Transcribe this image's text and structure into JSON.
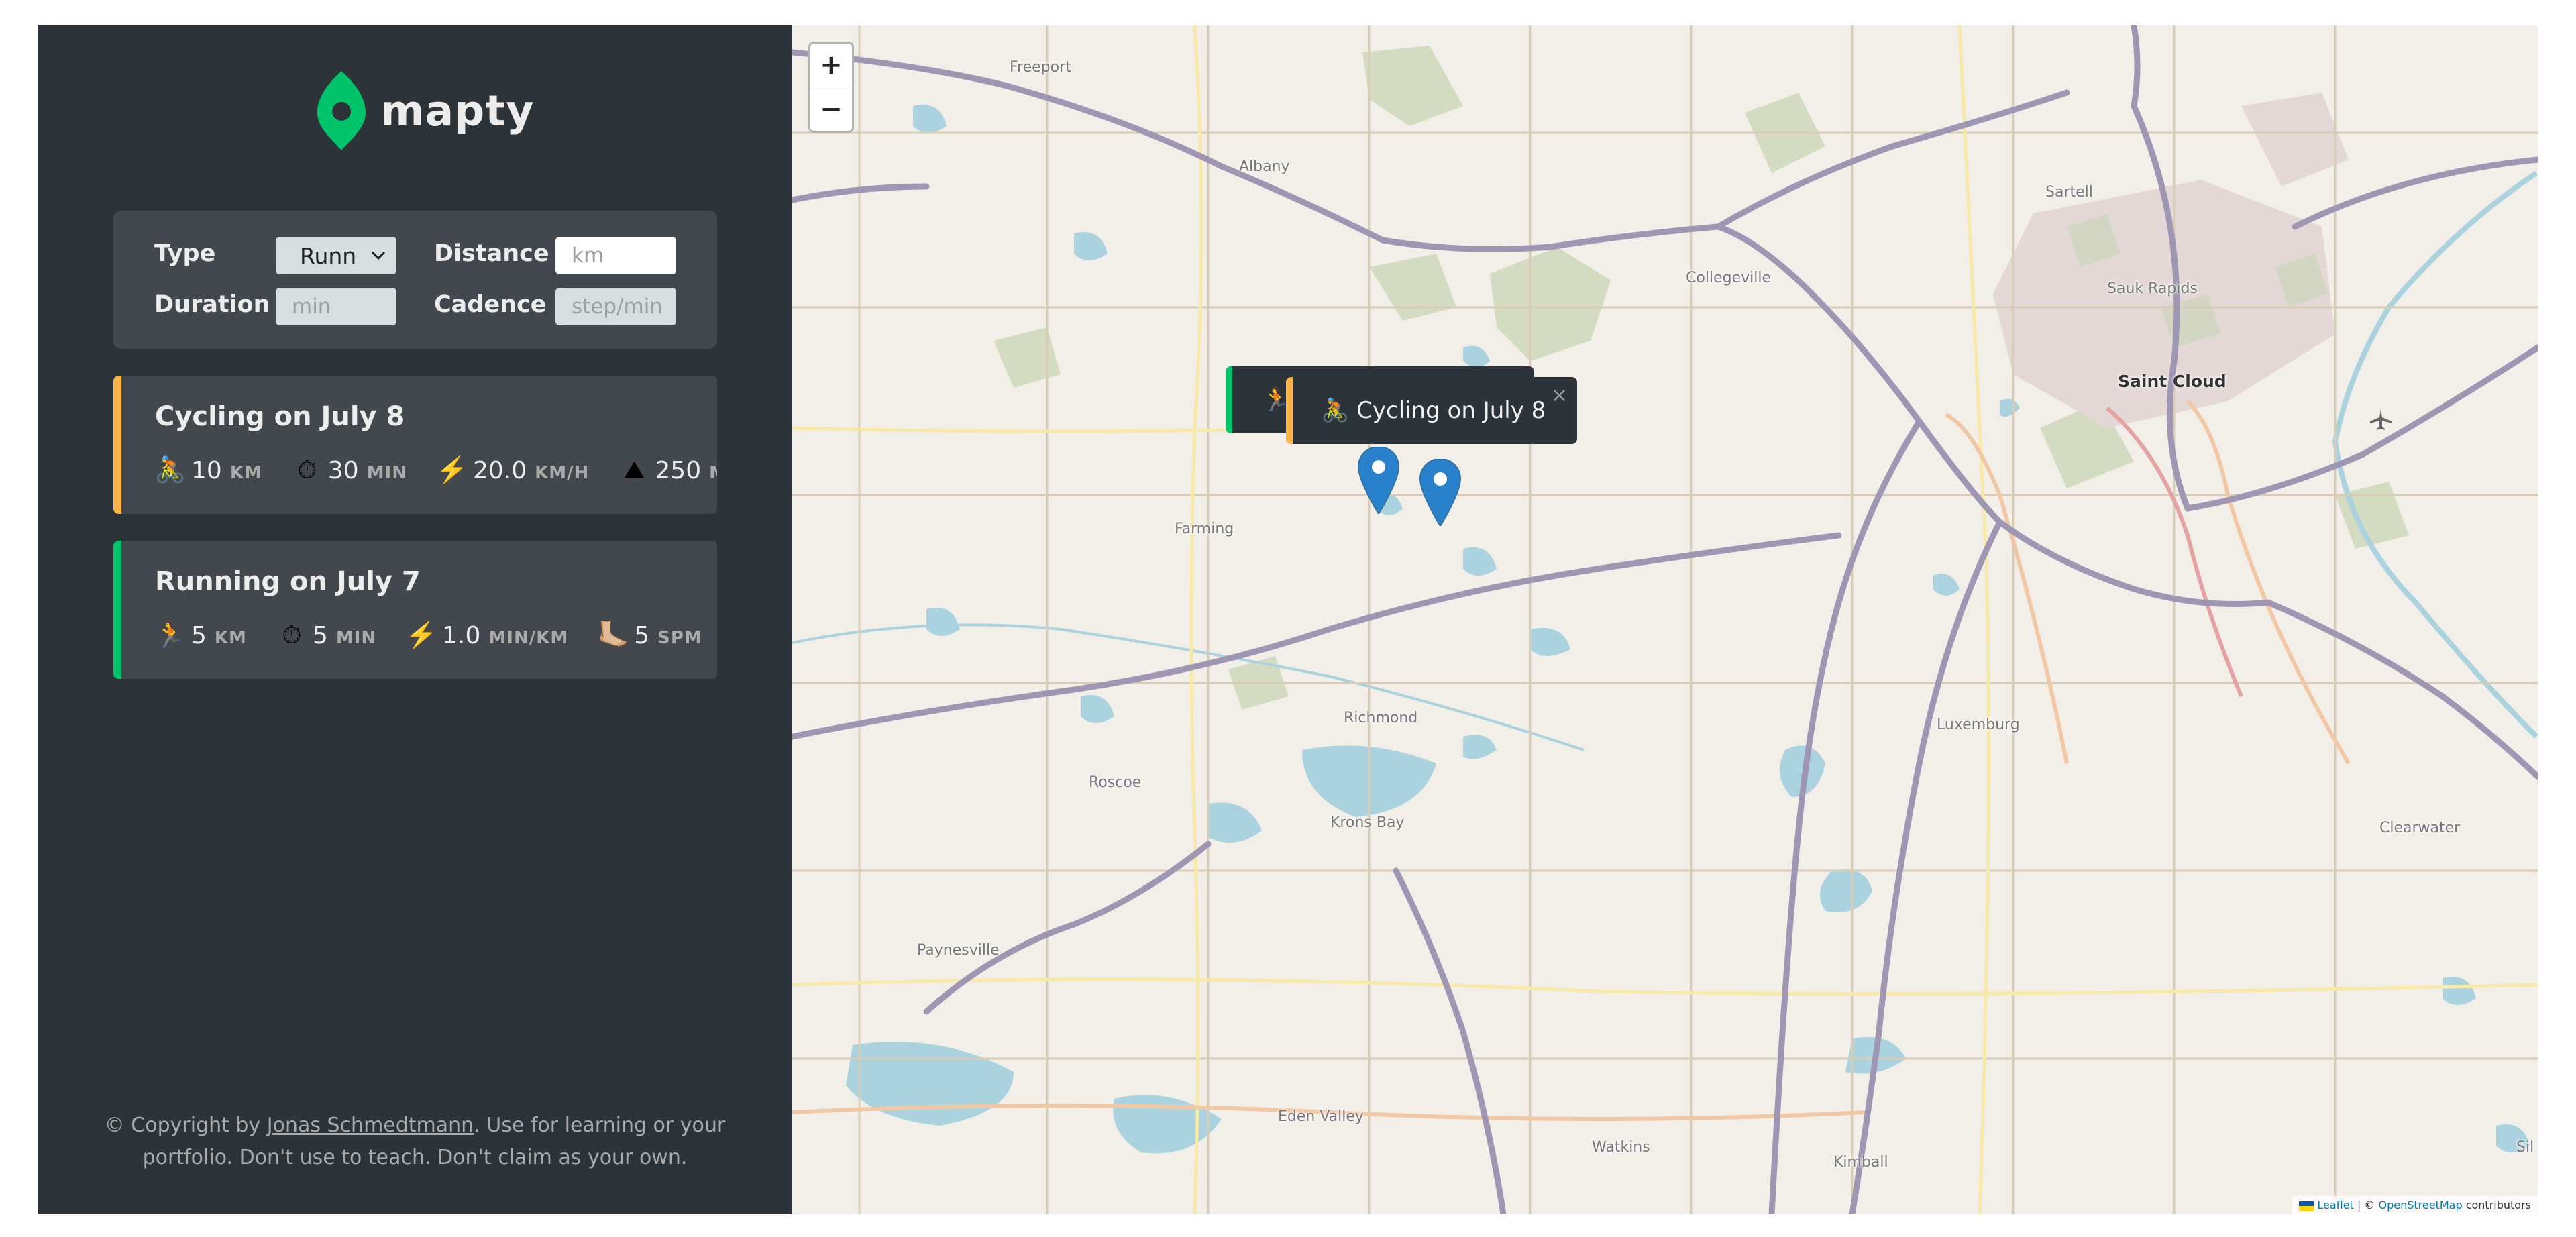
{
  "app": {
    "name": "mapty"
  },
  "form": {
    "type_label": "Type",
    "type_value": "Runn",
    "distance_label": "Distance",
    "distance_placeholder": "km",
    "duration_label": "Duration",
    "duration_placeholder": "min",
    "cadence_label": "Cadence",
    "cadence_placeholder": "step/min"
  },
  "workouts": [
    {
      "title": "Cycling on July 8",
      "kind": "cycling",
      "accent": "#ffb545",
      "details": [
        {
          "icon": "🚴",
          "value": "10",
          "unit": "KM"
        },
        {
          "icon": "⏱",
          "value": "30",
          "unit": "MIN"
        },
        {
          "icon": "⚡️",
          "value": "20.0",
          "unit": "KM/H"
        },
        {
          "icon": "⛰",
          "value": "250",
          "unit": "M"
        }
      ]
    },
    {
      "title": "Running on July 7",
      "kind": "running",
      "accent": "#00c46a",
      "details": [
        {
          "icon": "🏃",
          "value": "5",
          "unit": "KM"
        },
        {
          "icon": "⏱",
          "value": "5",
          "unit": "MIN"
        },
        {
          "icon": "⚡️",
          "value": "1.0",
          "unit": "MIN/KM"
        },
        {
          "icon": "🦶🏼",
          "value": "5",
          "unit": "SPM"
        }
      ]
    }
  ],
  "copyright": {
    "prefix": "© Copyright by ",
    "author": "Jonas Schmedtmann",
    "suffix": ". Use for learning or your portfolio. Don't use to teach. Don't claim as your own."
  },
  "map": {
    "zoom_in": "+",
    "zoom_out": "−",
    "popups": [
      {
        "icon": "🏃",
        "text": "",
        "accent": "#00c46a"
      },
      {
        "icon": "🚴",
        "text": "Cycling on July 8",
        "accent": "#ffb545",
        "close": "×"
      }
    ],
    "places": [
      "Freeport",
      "Albany",
      "Collegeville",
      "Sartell",
      "Sauk Rapids",
      "Saint Cloud",
      "Farming",
      "Richmond",
      "Luxemburg",
      "Roscoe",
      "Krons Bay",
      "Paynesville",
      "Eden Valley",
      "Watkins",
      "Kimball",
      "Clearwater",
      "Sil"
    ],
    "attribution": {
      "leaflet": "Leaflet",
      "sep": " | © ",
      "osm": "OpenStreetMap",
      "suffix": " contributors"
    }
  }
}
